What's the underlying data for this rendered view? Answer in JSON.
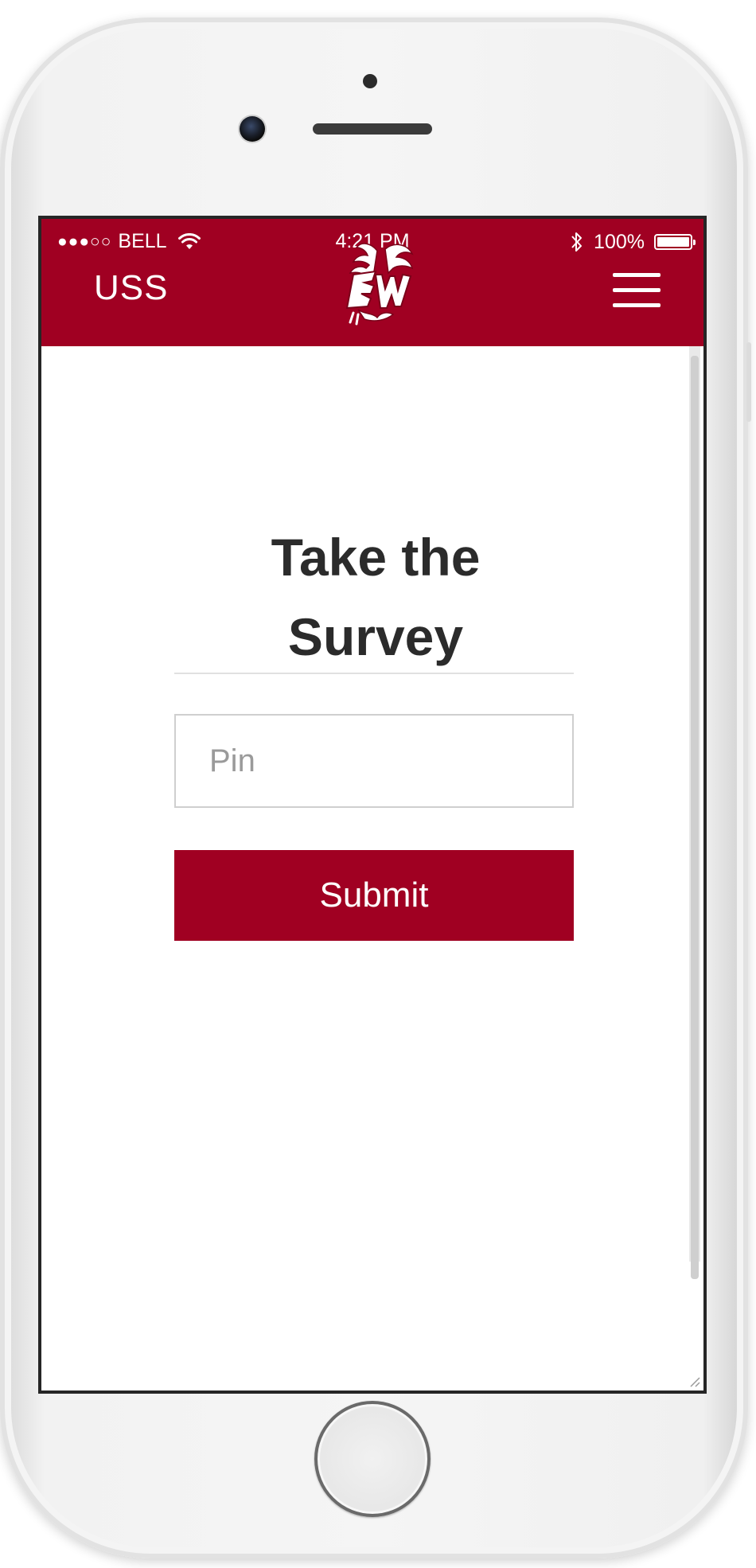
{
  "status_bar": {
    "carrier": "BELL",
    "signal_dots": "●●●○○",
    "time": "4:21 PM",
    "battery": "100%",
    "battery_level": 1.0
  },
  "header": {
    "brand": "USS",
    "logo_icon": "eagle-ew-logo",
    "menu_icon": "hamburger-menu-icon"
  },
  "main": {
    "title_line1": "Take the",
    "title_line2": "Survey",
    "pin_placeholder": "Pin",
    "pin_value": "",
    "submit_label": "Submit"
  },
  "colors": {
    "accent": "#a00022",
    "title_text": "#2b2b2b",
    "placeholder": "#9a9a9a"
  }
}
